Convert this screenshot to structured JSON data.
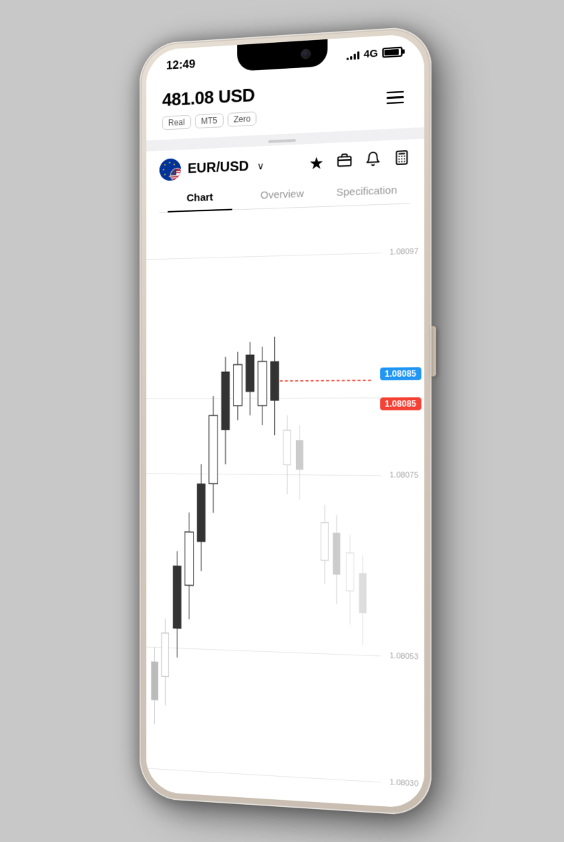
{
  "statusBar": {
    "time": "12:49",
    "network": "4G",
    "signalBars": [
      3,
      6,
      9,
      12,
      14
    ],
    "batteryLevel": 90
  },
  "accountCard": {
    "balance": "481.08 USD",
    "tags": [
      "Real",
      "MT5",
      "Zero"
    ],
    "menuLabel": "Menu"
  },
  "pairHeader": {
    "pairName": "EUR/USD",
    "chevron": "∨"
  },
  "actions": {
    "star": "★",
    "briefcase": "💼",
    "bell": "🔔",
    "calculator": "🖩"
  },
  "tabs": [
    {
      "label": "Chart",
      "active": true
    },
    {
      "label": "Overview",
      "active": false
    },
    {
      "label": "Specification",
      "active": false
    }
  ],
  "chart": {
    "priceLabels": [
      {
        "value": "1.08097",
        "pct": 8
      },
      {
        "value": "1.08075",
        "pct": 45
      },
      {
        "value": "1.08053",
        "pct": 75
      },
      {
        "value": "1.08030",
        "pct": 96
      }
    ],
    "currentPriceLine": 32,
    "badgeBuy": "1.08085",
    "badgeSell": "1.08085"
  }
}
